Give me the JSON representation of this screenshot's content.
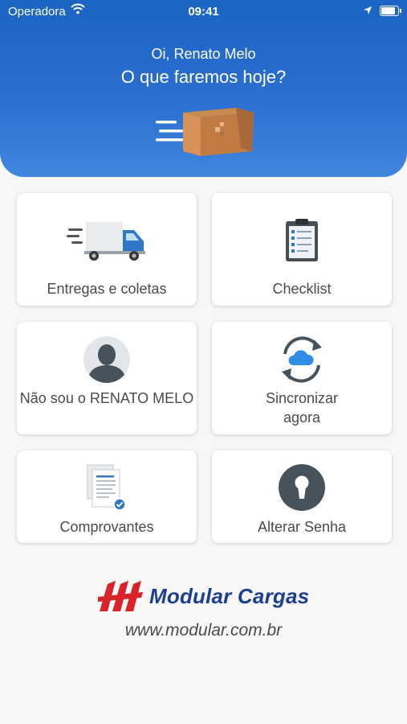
{
  "status_bar": {
    "carrier": "Operadora",
    "time": "09:41"
  },
  "header": {
    "greeting": "Oi, Renato Melo",
    "question": "O que faremos hoje?"
  },
  "menu": [
    {
      "label": "Entregas e coletas",
      "icon": "delivery-truck-icon"
    },
    {
      "label": "Checklist",
      "icon": "clipboard-checklist-icon"
    },
    {
      "label": "Não sou o RENATO MELO",
      "icon": "user-avatar-icon"
    },
    {
      "label": "Sincronizar agora",
      "icon": "cloud-sync-icon"
    },
    {
      "label": "Comprovantes",
      "icon": "documents-icon"
    },
    {
      "label": "Alterar Senha",
      "icon": "keyhole-lock-icon"
    }
  ],
  "footer": {
    "brand": "Modular Cargas",
    "website": "www.modular.com.br"
  },
  "colors": {
    "header_blue": "#2b6fd0",
    "brand_blue": "#1c3f8f",
    "brand_red": "#d8232a"
  }
}
